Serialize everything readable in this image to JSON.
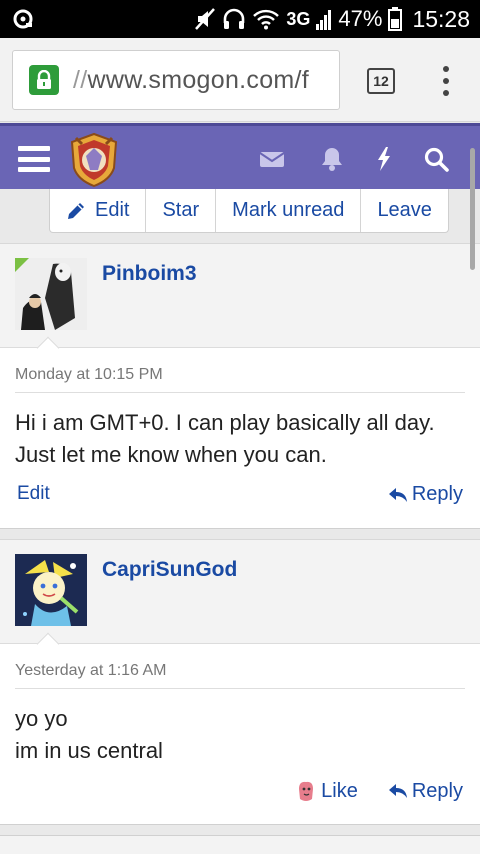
{
  "status_bar": {
    "network": "3G",
    "battery": "47%",
    "time": "15:28"
  },
  "browser": {
    "url_prefix": "//",
    "url_host": "www.smogon.com/f",
    "tab_count": "12"
  },
  "header": {
    "menu_icon": "hamburger-icon",
    "logo": "smogon-logo",
    "icons": [
      "mail-icon",
      "bell-icon",
      "bolt-icon",
      "search-icon"
    ],
    "accent": "#6a65b5"
  },
  "thread_actions": [
    {
      "label": "Edit",
      "icon": "pencil-icon"
    },
    {
      "label": "Star"
    },
    {
      "label": "Mark unread"
    },
    {
      "label": "Leave"
    }
  ],
  "posts": [
    {
      "username": "Pinboim3",
      "date": "Monday at 10:15 PM",
      "lines": [
        "Hi i am GMT+0. I can play basically all day.",
        "Just let me know when you can."
      ],
      "left_action": "Edit",
      "right_actions": [
        "Reply"
      ]
    },
    {
      "username": "CapriSunGod",
      "date": "Yesterday at 1:16 AM",
      "lines": [
        "yo yo",
        "im in us central"
      ],
      "left_action": "",
      "right_actions": [
        "Like",
        "Reply"
      ]
    }
  ]
}
